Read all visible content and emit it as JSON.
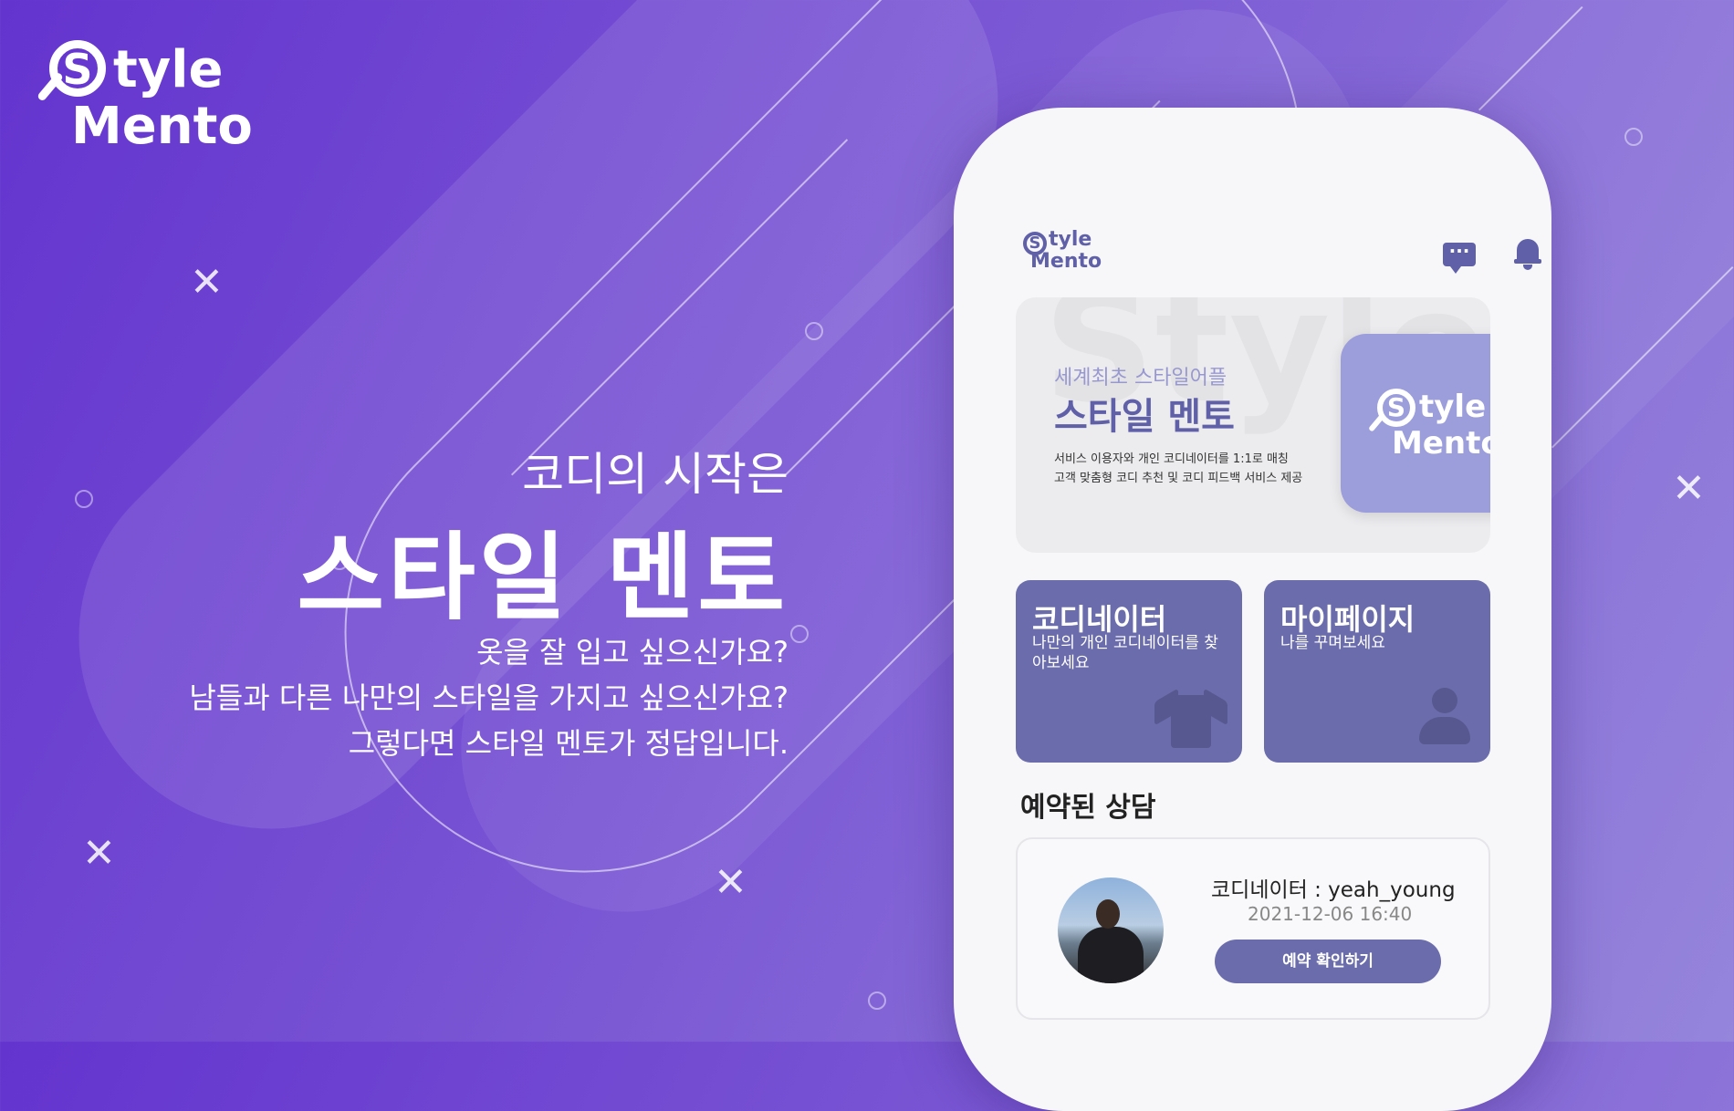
{
  "brand": {
    "logo_s": "S",
    "logo_word1": "tyle",
    "logo_word2": "Mento"
  },
  "hero": {
    "subtitle": "코디의 시작은",
    "title": "스타일 멘토",
    "line1": "옷을 잘 입고 싶으신가요?",
    "line2": "남들과 다른 나만의 스타일을 가지고 싶으신가요?",
    "line3": "그렇다면 스타일 멘토가 정답입니다."
  },
  "phone": {
    "header": {
      "logo_s": "S",
      "logo_word1": "tyle",
      "logo_word2": "Mento",
      "chat_icon": "chat-icon",
      "bell_icon": "bell-icon",
      "chat_glyph": "···"
    },
    "banner": {
      "watermark": "Style Mento",
      "subtitle": "세계최초 스타일어플",
      "title": "스타일 멘토",
      "desc1": "서비스 이용자와 개인 코디네이터를 1:1로 매칭",
      "desc2": "고객 맞춤형 코디 추천 및 코디 피드백 서비스 제공",
      "app_s": "S",
      "app_word1": "tyle",
      "app_word2": "Mento"
    },
    "cards": [
      {
        "title": "코디네이터",
        "desc": "나만의 개인 코디네이터를 찾아보세요",
        "icon": "shirt-icon"
      },
      {
        "title": "마이페이지",
        "desc": "나를 꾸며보세요",
        "icon": "person-icon"
      }
    ],
    "section_title": "예약된 상담",
    "reservation": {
      "coordinator": "코디네이터 : yeah_young",
      "datetime": "2021-12-06 16:40",
      "button_label": "예약 확인하기"
    }
  },
  "colors": {
    "accent": "#6b6cab",
    "brand_dark": "#5f60a8",
    "background_start": "#6434cf",
    "background_end": "#9585db"
  }
}
